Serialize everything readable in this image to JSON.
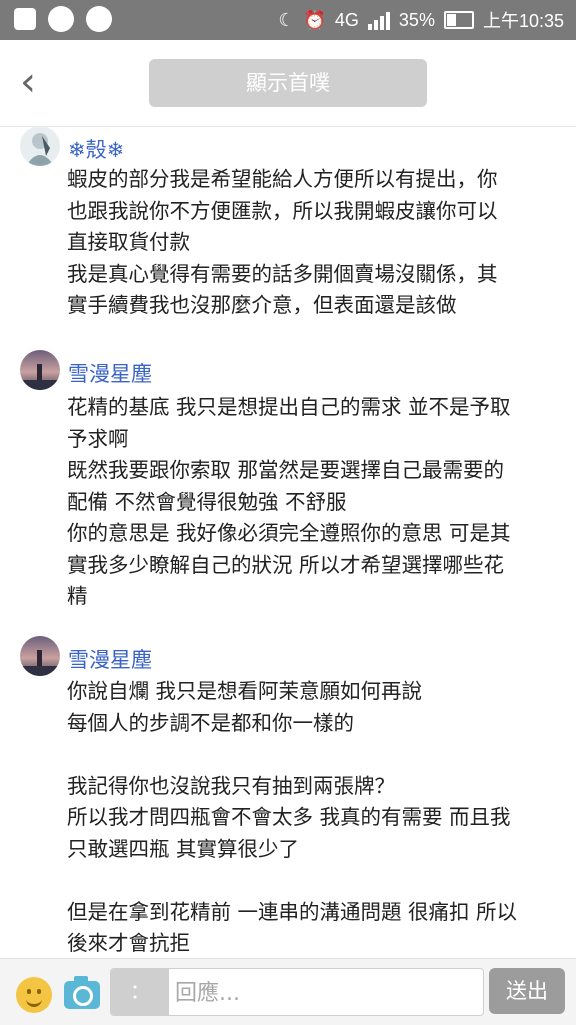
{
  "status_bar": {
    "network": "4G",
    "battery": "35%",
    "time": "上午10:35",
    "icons": [
      "menu-icon",
      "notification-icon",
      "notification-icon",
      "moon-icon",
      "alarm-icon",
      "signal-icon",
      "battery-icon"
    ]
  },
  "header": {
    "back_icon": "chevron-left-icon",
    "show_button_label": "顯示首噗"
  },
  "posts": [
    {
      "author": "❄殼❄",
      "lines": [
        "蝦皮的部分我是希望能給人方便所以有提出，你",
        "也跟我說你不方便匯款，所以我開蝦皮讓你可以",
        "直接取貨付款",
        "我是真心覺得有需要的話多開個賣場沒關係，其",
        "實手續費我也沒那麼介意，但表面還是該做"
      ]
    },
    {
      "author": "雪漫星塵",
      "lines": [
        "花精的基底 我只是想提出自己的需求 並不是予取",
        "予求啊",
        "既然我要跟你索取 那當然是要選擇自己最需要的",
        "配備 不然會覺得很勉強 不舒服",
        "你的意思是 我好像必須完全遵照你的意思 可是其",
        "實我多少瞭解自己的狀況 所以才希望選擇哪些花",
        "精"
      ]
    },
    {
      "author": "雪漫星塵",
      "lines": [
        "你說自爛 我只是想看阿茉意願如何再說",
        "每個人的步調不是都和你一樣的",
        "",
        "我記得你也沒說我只有抽到兩張牌？",
        "所以我才問四瓶會不會太多 我真的有需要 而且我",
        "只敢選四瓶 其實算很少了",
        "",
        "但是在拿到花精前 一連串的溝通問題 很痛扣 所以",
        "後來才會抗拒"
      ]
    }
  ],
  "composer": {
    "emoji_icon": "smiley-icon",
    "camera_icon": "camera-icon",
    "qualifier_label": "：",
    "placeholder": "回應...",
    "send_label": "送出"
  },
  "colors": {
    "status_bar": "#7a7a7a",
    "author_name": "#3a64c4",
    "show_button": "#cfcfcf",
    "send_button": "#9c9c9c"
  }
}
